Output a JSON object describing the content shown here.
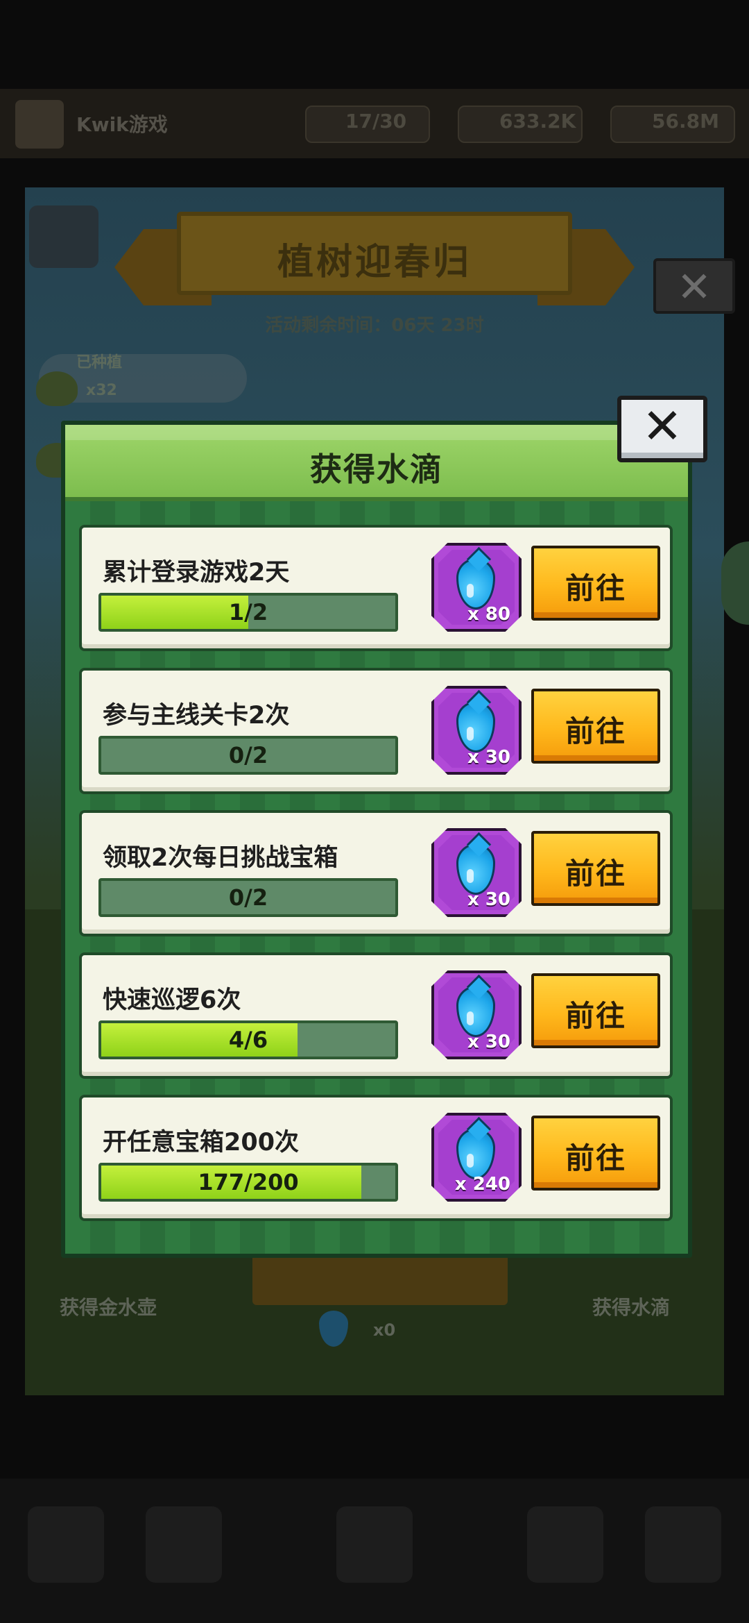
{
  "background": {
    "topbar": {
      "player_name": "Kwik游戏",
      "stat_energy": "17/30",
      "stat_gold": "633.2K",
      "stat_gems": "56.8M"
    },
    "event_title": "植树迎春归",
    "event_timer": "活动剩余时间：06天 23时",
    "planted_label": "已种植",
    "planted_count": "x32",
    "left_button_label": "获得金水壶",
    "right_button_label": "获得水滴",
    "water_count": "x0"
  },
  "modal": {
    "title": "获得水滴",
    "close_icon": "close-icon",
    "tasks": [
      {
        "title": "累计登录游戏2天",
        "progress_text": "1/2",
        "progress": 0.5,
        "reward_qty": "x 80",
        "button": "前往"
      },
      {
        "title": "参与主线关卡2次",
        "progress_text": "0/2",
        "progress": 0.0,
        "reward_qty": "x 30",
        "button": "前往"
      },
      {
        "title": "领取2次每日挑战宝箱",
        "progress_text": "0/2",
        "progress": 0.0,
        "reward_qty": "x 30",
        "button": "前往"
      },
      {
        "title": "快速巡逻6次",
        "progress_text": "4/6",
        "progress": 0.6667,
        "reward_qty": "x 30",
        "button": "前往"
      },
      {
        "title": "开任意宝箱200次",
        "progress_text": "177/200",
        "progress": 0.885,
        "reward_qty": "x 240",
        "button": "前往"
      }
    ]
  },
  "colors": {
    "modal_body": "#2f7a40",
    "header_green": "#8fca5a",
    "progress_fill": "#a6e22a",
    "reward_purple": "#b14ad7",
    "button_yellow": "#ffb81c"
  }
}
